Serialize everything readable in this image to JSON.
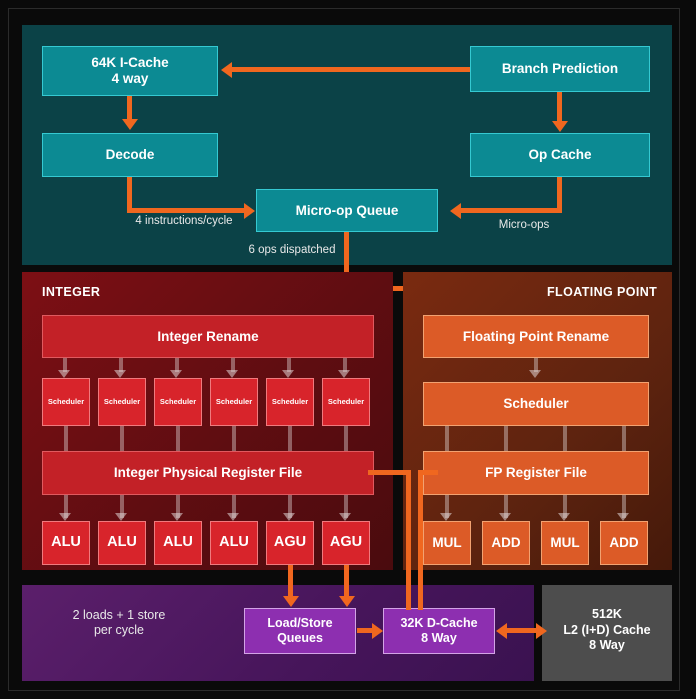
{
  "diagram": {
    "title": "CPU Core Microarchitecture Block Diagram",
    "colors": {
      "frontend_bg": "#0b4247",
      "frontend_box": "#0c8a93",
      "integer_bg": "#7d0f14",
      "integer_box": "#d8242b",
      "float_bg": "#7a2a10",
      "float_box": "#dc5b27",
      "memory_bg": "#5b1f6b",
      "memory_box": "#8d2fb0",
      "l2_bg": "#4d4d4d",
      "arrow": "#f0671f"
    }
  },
  "frontend": {
    "icache": "64K I-Cache\n4 way",
    "decode": "Decode",
    "branch_prediction": "Branch Prediction",
    "op_cache": "Op Cache",
    "microop_queue": "Micro-op Queue",
    "label_instructions": "4 instructions/cycle",
    "label_microops": "Micro-ops",
    "label_dispatch": "6 ops dispatched"
  },
  "integer": {
    "section_title": "INTEGER",
    "rename": "Integer Rename",
    "register_file": "Integer Physical Register File",
    "schedulers": [
      "Scheduler",
      "Scheduler",
      "Scheduler",
      "Scheduler",
      "Scheduler",
      "Scheduler"
    ],
    "units": [
      "ALU",
      "ALU",
      "ALU",
      "ALU",
      "AGU",
      "AGU"
    ]
  },
  "floating_point": {
    "section_title": "FLOATING POINT",
    "rename": "Floating Point Rename",
    "scheduler": "Scheduler",
    "register_file": "FP Register File",
    "units": [
      "MUL",
      "ADD",
      "MUL",
      "ADD"
    ]
  },
  "memory": {
    "label_throughput": "2 loads + 1 store\nper cycle",
    "load_store_queues": "Load/Store\nQueues",
    "d_cache": "32K D-Cache\n8 Way",
    "l2_cache": "512K\nL2 (I+D) Cache\n8 Way"
  }
}
